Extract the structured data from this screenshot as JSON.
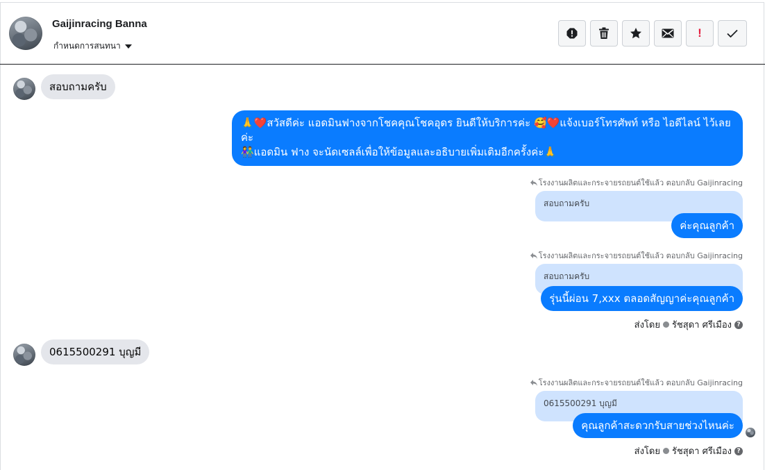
{
  "header": {
    "name": "Gaijinracing Banna",
    "subtitle": "กำหนดการสนทนา",
    "actions": [
      {
        "icon": "alert-circle-icon",
        "name": "spam-button"
      },
      {
        "icon": "trash-icon",
        "name": "delete-button"
      },
      {
        "icon": "star-icon",
        "name": "star-button"
      },
      {
        "icon": "envelope-icon",
        "name": "mark-unread-button"
      },
      {
        "icon": "exclamation-icon",
        "name": "follow-up-button",
        "text": "!"
      },
      {
        "icon": "check-icon",
        "name": "done-button"
      }
    ]
  },
  "messages": {
    "in1": "สอบถามครับ",
    "out1_line1": "🙏❤️สวัสดีค่ะ แอดมินฟางจากโชคคุณโชคอุดร ยินดีให้บริการค่ะ 🥰❤️แจ้งเบอร์โทรศัพท์ หรือ ไอดีไลน์ ไว้เลยค่ะ",
    "out1_line2": "👫แอดมิน ฟาง จะนัดเซลล์เพื่อให้ข้อมูลและอธิบายเพิ่มเติมอีกครั้งค่ะ🙏",
    "reply1_label": "โรงงานผลิตและกระจายรถยนต์ใช้แล้ว ตอบกลับ Gaijinracing",
    "reply1_quote": "สอบถามครับ",
    "out2": "ค่ะคุณลูกค้า",
    "reply2_label": "โรงงานผลิตและกระจายรถยนต์ใช้แล้ว ตอบกลับ Gaijinracing",
    "reply2_quote": "สอบถามครับ",
    "out3": "รุ่นนี้ผ่อน 7,xxx ตลอดสัญญาค่ะคุณลูกค้า",
    "sent_by_1_prefix": "ส่งโดย",
    "sent_by_1_name": "รัชสุดา ศรีเมือง",
    "in2": "0615500291 บุญมี",
    "reply3_label": "โรงงานผลิตและกระจายรถยนต์ใช้แล้ว ตอบกลับ Gaijinracing",
    "reply3_quote": "0615500291 บุญมี",
    "out4": "คุณลูกค้าสะดวกรับสายช่วงไหนค่ะ",
    "sent_by_2_prefix": "ส่งโดย",
    "sent_by_2_name": "รัชสุดา ศรีเมือง"
  },
  "colors": {
    "outgoing_bubble": "#0a7cff",
    "incoming_bubble": "#e4e6eb",
    "quote_bubble": "#cfe3fe",
    "follow_up_red": "#e41e3f"
  }
}
